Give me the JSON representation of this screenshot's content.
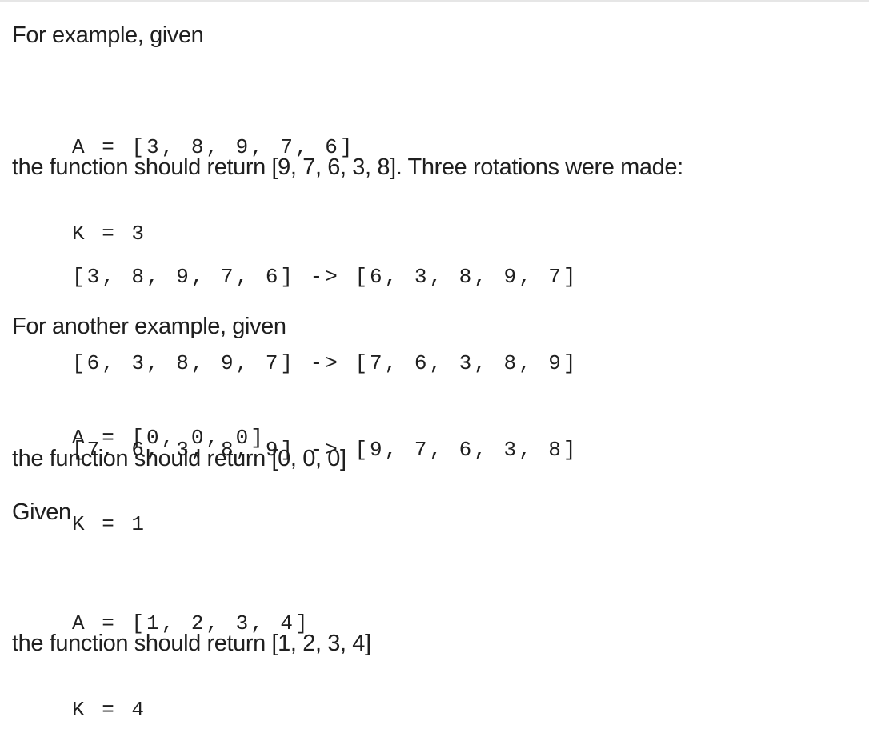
{
  "intro_1": "For example, given",
  "example_1": {
    "line_a": "A = [3, 8, 9, 7, 6]",
    "line_k": "K = 3"
  },
  "result_1": "the function should return [9, 7, 6, 3, 8]. Three rotations were made:",
  "rotations": [
    "[3, 8, 9, 7, 6] -> [6, 3, 8, 9, 7]",
    "[6, 3, 8, 9, 7] -> [7, 6, 3, 8, 9]",
    "[7, 6, 3, 8, 9] -> [9, 7, 6, 3, 8]"
  ],
  "intro_2": "For another example, given",
  "example_2": {
    "line_a": "A = [0, 0, 0]",
    "line_k": "K = 1"
  },
  "result_2": "the function should return [0, 0, 0]",
  "intro_3": "Given",
  "example_3": {
    "line_a": "A = [1, 2, 3, 4]",
    "line_k": "K = 4"
  },
  "result_3": "the function should return [1, 2, 3, 4]"
}
